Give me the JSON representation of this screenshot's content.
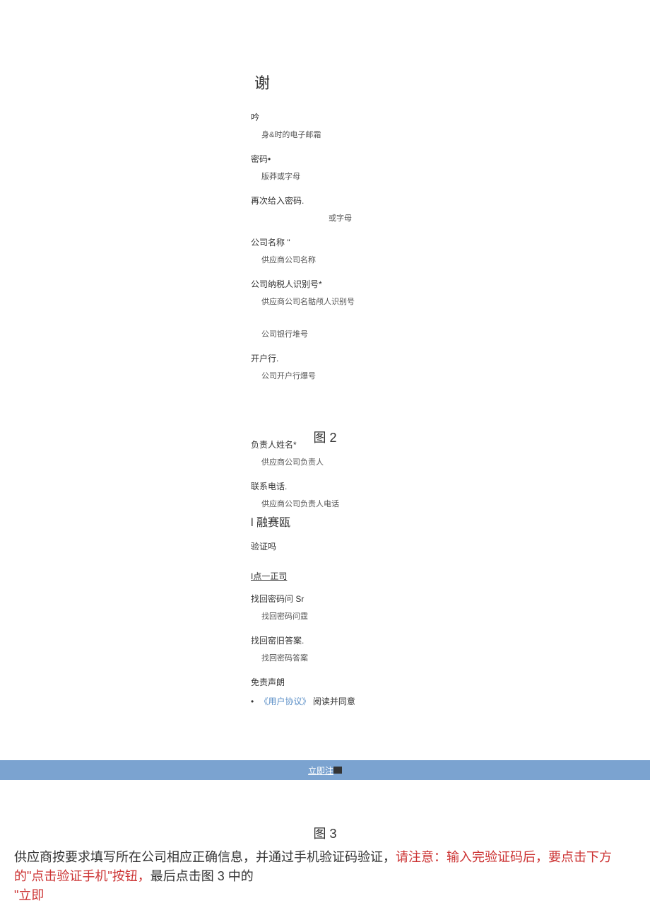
{
  "form1": {
    "title": "谢",
    "yin_label": "吟",
    "yin_hint": "身&时的电子邮霜",
    "password_label": "密码•",
    "password_hint": "版莽或字母",
    "password_again_label": "再次给入密码.",
    "password_again_hint": "或字母",
    "company_name_label": "公司名称 \"",
    "company_name_hint": "供应商公司名称",
    "tax_id_label": "公司纳税人识别号*",
    "tax_id_hint": "供应商公司名骷颅人识别号",
    "bank_hint": "公司银行堆号",
    "bank_branch_label": "开户行.",
    "bank_branch_hint": "公司开户行爆号"
  },
  "figure2_label": "图 2",
  "form2": {
    "owner_name_label": "负责人姓名*",
    "owner_name_hint": "供应商公司负责人",
    "phone_label": "联系电话.",
    "phone_hint": "供应商公司负责人电话",
    "lrsa": "l 融赛瓯",
    "verify_label": "验证吗",
    "underline1": "I点一正司",
    "recover_q_label": "找回密码问 Sr",
    "recover_q_hint": "找回密码问霆",
    "recover_a_label": "找回窑旧答案.",
    "recover_a_hint": "找回密码答案",
    "disclaimer_label": "免责声朗",
    "bullet": "•",
    "agreement_link": "《用户协议》",
    "agreement_suffix": "阅读并同意"
  },
  "register_button": "立即注",
  "figure3_label": "图 3",
  "instruction": {
    "part1": "供应商按要求填写所在公司相应正确信息，并通过手机验证码验证，",
    "part2_red": "请注意：输入完验证码后，要点击下方的\"点击验证手机\"按钮，",
    "part3": "最后点击图 3 中的",
    "part4_red": "\"立即"
  }
}
